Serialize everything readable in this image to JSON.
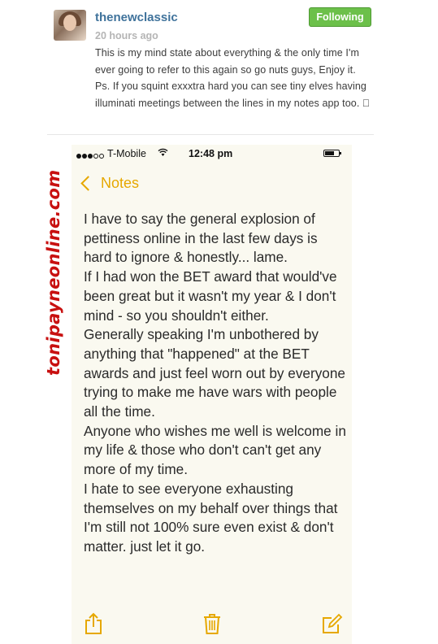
{
  "post": {
    "username": "thenewclassic",
    "timestamp": "20 hours ago",
    "follow_label": "Following",
    "caption": "This is my mind state about everything & the only time I'm ever going to refer to this again so go nuts guys, Enjoy it. Ps. If you squint exxxtra hard you can see tiny elves having illuminati meetings between the lines in my notes app too. 🏻"
  },
  "phone": {
    "status": {
      "carrier": "T-Mobile",
      "time": "12:48 pm"
    },
    "nav": {
      "back_label": "Notes"
    },
    "note_paragraphs": [
      "I have to say the general explosion of pettiness online in the last few days is hard to ignore & honestly... lame.",
      "If I had won the BET award that would've been great but it wasn't my year & I don't mind - so you shouldn't either.",
      "Generally speaking I'm unbothered by anything that \"happened\" at the BET awards and just feel worn out by everyone trying to make me have wars with people all the time.",
      "Anyone who wishes me well is welcome in my life & those who don't can't get any more of my time.",
      "I hate to see everyone exhausting themselves on my behalf over things that I'm still not 100% sure even exist & don't matter. just let it go."
    ],
    "toolbar_icons": [
      "share-icon",
      "trash-icon",
      "compose-icon"
    ]
  },
  "watermark": "tonipayneonline.com",
  "colors": {
    "username": "#3f729b",
    "follow_button": "#6cc04a",
    "notes_accent": "#e6a800",
    "notes_paper": "#faf9f0",
    "watermark": "#c81010"
  }
}
